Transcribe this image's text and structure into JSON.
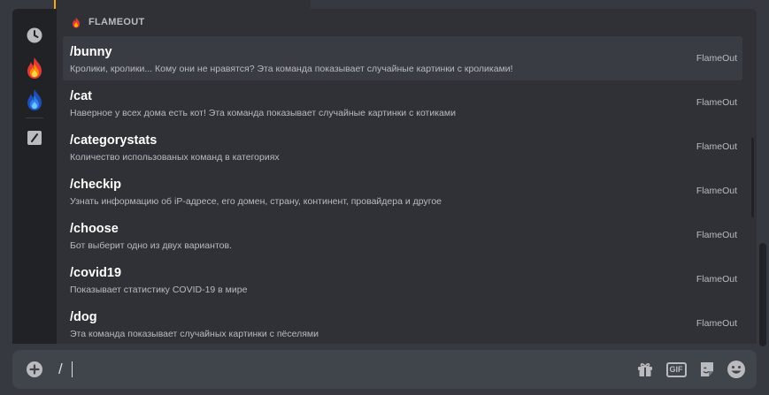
{
  "section": {
    "title": "FLAMEOUT"
  },
  "commands": [
    {
      "name": "/bunny",
      "description": "Кролики, кролики... Кому они не нравятся? Эта команда показывает случайные картинки с кроликами!",
      "app": "FlameOut"
    },
    {
      "name": "/cat",
      "description": "Наверное у всех дома есть кот! Эта команда показывает случайные картинки с котиками",
      "app": "FlameOut"
    },
    {
      "name": "/categorystats",
      "description": "Количество использованых команд в категориях",
      "app": "FlameOut"
    },
    {
      "name": "/checkip",
      "description": "Узнать информацию об iP-адресе, его домен, страну, континент, провайдера и другое",
      "app": "FlameOut"
    },
    {
      "name": "/choose",
      "description": "Бот выберит одно из двух вариантов.",
      "app": "FlameOut"
    },
    {
      "name": "/covid19",
      "description": "Показывает статистику COVID-19 в мире",
      "app": "FlameOut"
    },
    {
      "name": "/dog",
      "description": "Эта команда показывает случайных картинки с пёселями",
      "app": "FlameOut"
    }
  ],
  "composer": {
    "value": "/"
  },
  "toolbar": {
    "gif_label": "GIF"
  },
  "colors": {
    "accent": "#faa61a",
    "blue_flame": "#2f80ed",
    "orange_flame": "#f57c00"
  }
}
